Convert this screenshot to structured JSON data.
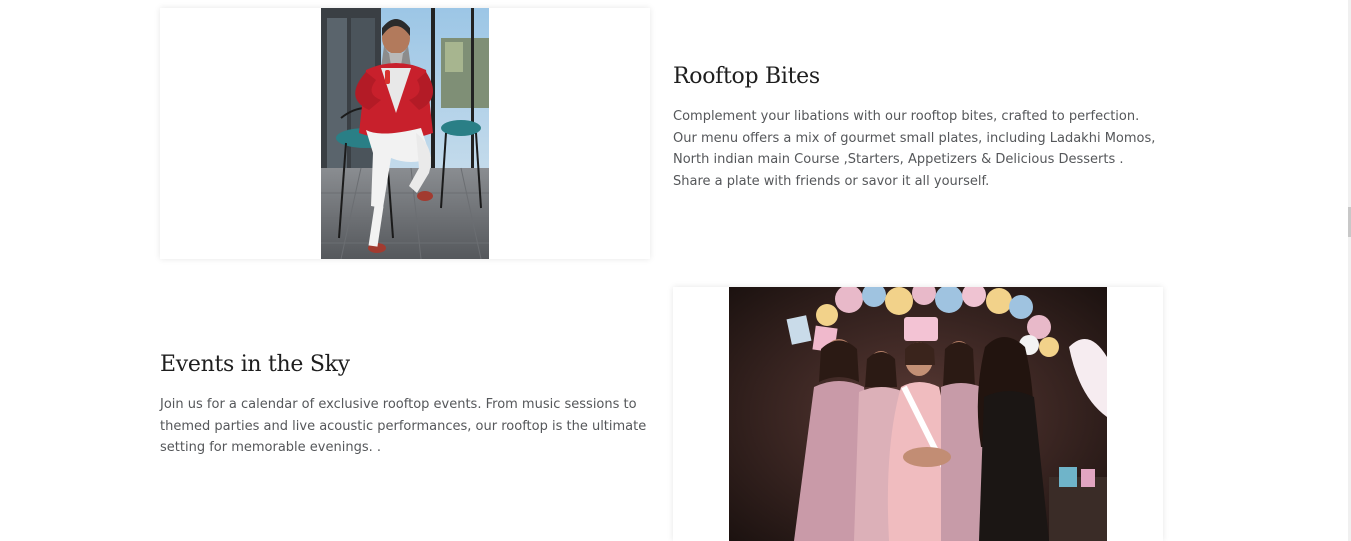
{
  "sections": [
    {
      "title": "Rooftop Bites",
      "text": "Complement your libations with our rooftop bites, crafted to perfection. Our menu offers a mix of gourmet small plates, including Ladakhi Momos, North indian main Course ,Starters, Appetizers & Delicious Desserts . Share a plate with friends or savor it all yourself.",
      "image_subject": "man-in-red-blazer-seated-on-rooftop"
    },
    {
      "title": "Events in the Sky",
      "text": "Join us for a calendar of exclusive rooftop events. From music sessions to themed parties and live acoustic performances, our rooftop is the ultimate setting for memorable evenings. .",
      "image_subject": "group-of-women-at-baby-shower-party"
    }
  ],
  "colors": {
    "background": "#ffffff",
    "title": "#1e1e1e",
    "body_text": "#55575a",
    "blazer_red": "#c8202c",
    "party_pink": "#e3b3c4"
  }
}
